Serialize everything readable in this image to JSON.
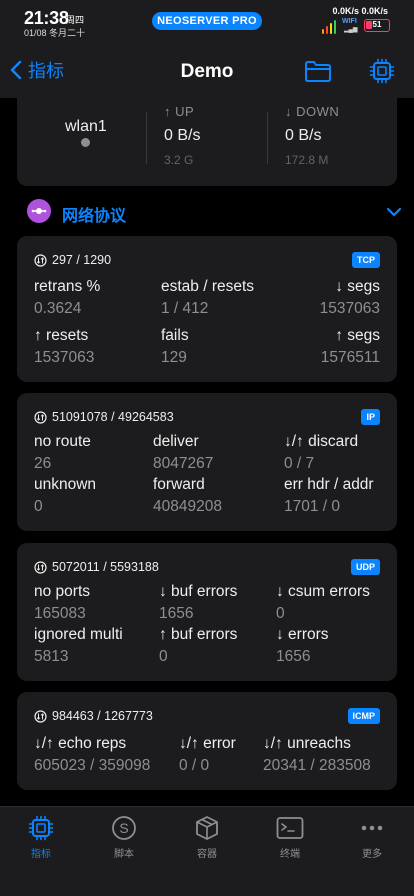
{
  "status_bar": {
    "time": "21:38",
    "weekday": "周四",
    "date": "01/08 冬月二十",
    "app_badge": "NEOSERVER PRO",
    "net_speed": "0.0K/s 0.0K/s",
    "wifi_label": "WIFI",
    "battery": "51"
  },
  "nav": {
    "back_label": "指标",
    "title": "Demo",
    "folder_icon": "folder-icon",
    "chip_icon": "chip-icon"
  },
  "interface": {
    "name": "wlan1",
    "up_label": "↑ UP",
    "up_rate": "0 B/s",
    "up_total": "3.2 G",
    "down_label": "↓ DOWN",
    "down_rate": "0 B/s",
    "down_total": "172.8 M"
  },
  "section": {
    "title": "网络协议",
    "icon": "network-protocol-icon",
    "accent_color": "#af52de"
  },
  "protocols": [
    {
      "header": "297 / 1290",
      "badge": "TCP",
      "cells": [
        {
          "k": "retrans %",
          "v": "0.3624"
        },
        {
          "k": "estab / resets",
          "v": "1 / 412"
        },
        {
          "k": "↓ segs",
          "v": "1537063"
        },
        {
          "k": "↑ resets",
          "v": "1537063"
        },
        {
          "k": "fails",
          "v": "129"
        },
        {
          "k": "↑ segs",
          "v": "1576511"
        }
      ]
    },
    {
      "header": "51091078 / 49264583",
      "badge": "IP",
      "cells": [
        {
          "k": "no route",
          "v": "26"
        },
        {
          "k": "deliver",
          "v": "8047267"
        },
        {
          "k": "↓/↑ discard",
          "v": "0 / 7"
        },
        {
          "k": "unknown",
          "v": "0"
        },
        {
          "k": "forward",
          "v": "40849208"
        },
        {
          "k": "err hdr / addr",
          "v": "1701 / 0"
        }
      ]
    },
    {
      "header": "5072011 / 5593188",
      "badge": "UDP",
      "cells": [
        {
          "k": "no ports",
          "v": "165083"
        },
        {
          "k": "↓ buf errors",
          "v": "1656"
        },
        {
          "k": "↓ csum errors",
          "v": "0"
        },
        {
          "k": "ignored multi",
          "v": "5813"
        },
        {
          "k": "↑ buf errors",
          "v": "0"
        },
        {
          "k": "↓ errors",
          "v": "1656"
        }
      ]
    },
    {
      "header": "984463 / 1267773",
      "badge": "ICMP",
      "cells": [
        {
          "k": "↓/↑ echo reps",
          "v": "605023 / 359098"
        },
        {
          "k": "↓/↑ error",
          "v": "0 / 0"
        },
        {
          "k": "↓/↑ unreachs",
          "v": "20341 / 283508"
        }
      ]
    }
  ],
  "tabs": [
    {
      "label": "指标",
      "icon": "chip-icon",
      "active": true
    },
    {
      "label": "脚本",
      "icon": "script-icon",
      "active": false
    },
    {
      "label": "容器",
      "icon": "container-icon",
      "active": false
    },
    {
      "label": "终端",
      "icon": "terminal-icon",
      "active": false
    },
    {
      "label": "更多",
      "icon": "more-icon",
      "active": false
    }
  ],
  "colors": {
    "accent": "#0a84ff",
    "card": "#1c1c1e",
    "background": "#000000"
  }
}
